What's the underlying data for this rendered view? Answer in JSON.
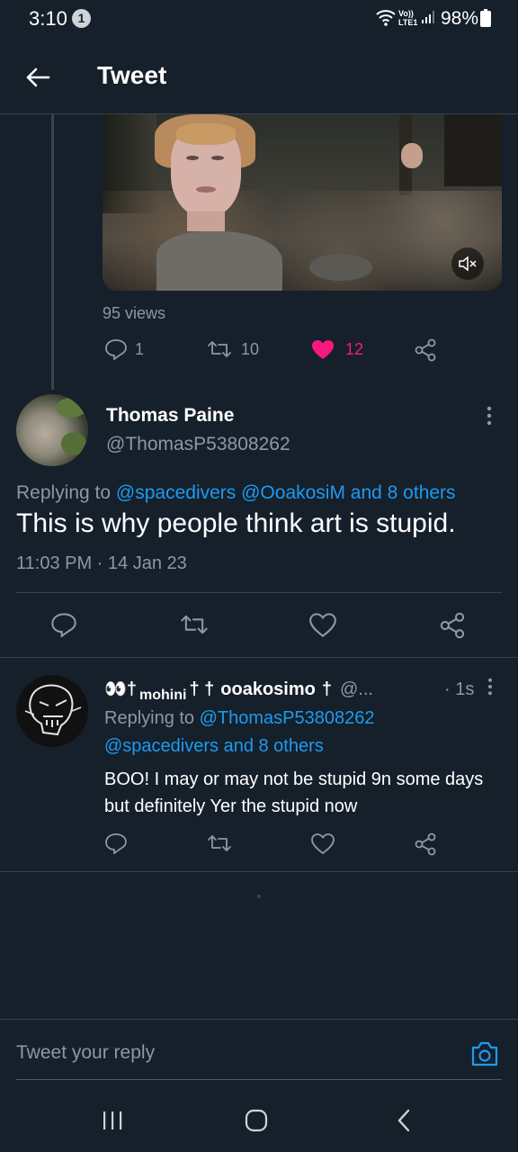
{
  "status_bar": {
    "time": "3:10",
    "notification_count": "1",
    "network": "Vo)) LTE1",
    "battery": "98%"
  },
  "header": {
    "title": "Tweet"
  },
  "parent_tweet": {
    "views": "95 views",
    "replies": "1",
    "retweets": "10",
    "likes": "12",
    "like_color": "#f91880"
  },
  "focused_tweet": {
    "display_name": "Thomas Paine",
    "handle": "@ThomasP53808262",
    "replying_prefix": "Replying to",
    "replying_to": "@spacedivers @OoakosiM and 8 others",
    "text": "This is why people think art is stupid.",
    "timestamp": "11:03 PM · 14 Jan 23"
  },
  "reply_tweet": {
    "display_name_part1": "👀†",
    "display_name_sub": "mohini",
    "display_name_part2": "† †",
    "display_name_part3": "ooakosimo",
    "display_name_part4": "†",
    "handle": "@...",
    "age": "· 1s",
    "replying_prefix": "Replying to",
    "replying_to_1": "@ThomasP53808262",
    "replying_to_2": "@spacedivers and 8 others",
    "text": "BOO! I may or may not be stupid 9n some days but definitely Yer the stupid now"
  },
  "composer": {
    "placeholder": "Tweet your reply"
  },
  "colors": {
    "background": "#15202b",
    "accent": "#1d9bf0",
    "muted": "#8b98a5",
    "divider": "#38444d"
  }
}
